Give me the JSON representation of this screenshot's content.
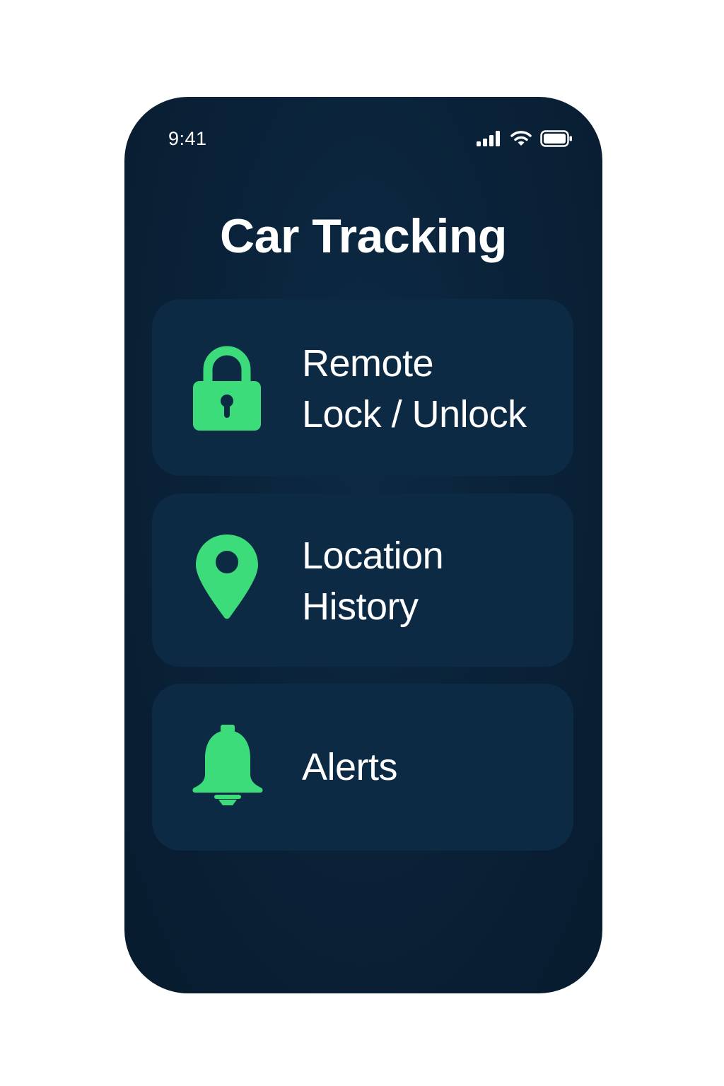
{
  "status_bar": {
    "time": "9:41",
    "icons": [
      "signal-icon",
      "wifi-icon",
      "battery-icon"
    ]
  },
  "title": "Car Tracking",
  "colors": {
    "background": "#0b2238",
    "card": "#0d2a45",
    "accent": "#3ddc7a",
    "text": "#ffffff"
  },
  "menu": [
    {
      "icon": "lock-icon",
      "lines": [
        "Remote",
        "Lock / Unlock"
      ]
    },
    {
      "icon": "location-pin-icon",
      "lines": [
        "Location",
        "History"
      ]
    },
    {
      "icon": "bell-icon",
      "lines": [
        "Alerts"
      ]
    }
  ]
}
